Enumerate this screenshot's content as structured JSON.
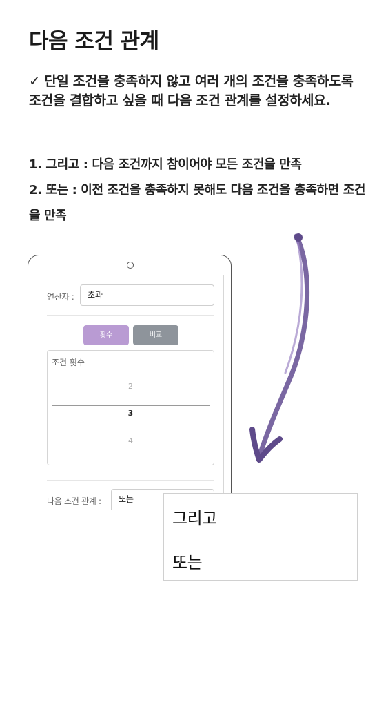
{
  "title": "다음 조건 관계",
  "intro": "✓ 단일 조건을 충족하지 않고 여러 개의 조건을 충족하도록 조건을 결합하고 싶을 때 다음 조건 관계를 설정하세요.",
  "rules": [
    "1. 그리고 : 다음 조건까지 참이어야 모든 조건을 만족",
    "2. 또는 : 이전 조건을 충족하지 못해도 다음 조건을 충족하면 조건을 만족"
  ],
  "tablet": {
    "operator_label": "연산자 :",
    "operator_value": "초과",
    "tab_count": "횟수",
    "tab_compare": "비교",
    "picker_title": "조건 횟수",
    "picker_values": [
      "2",
      "3",
      "4"
    ],
    "relation_label": "다음 조건 관계 :",
    "relation_value": "또는"
  },
  "dropdown": {
    "options": [
      "그리고",
      "또는"
    ]
  },
  "colors": {
    "accent_purple": "#b99bd3",
    "tab_gray": "#8e949b",
    "arrow_purple": "#6f5a9a"
  }
}
